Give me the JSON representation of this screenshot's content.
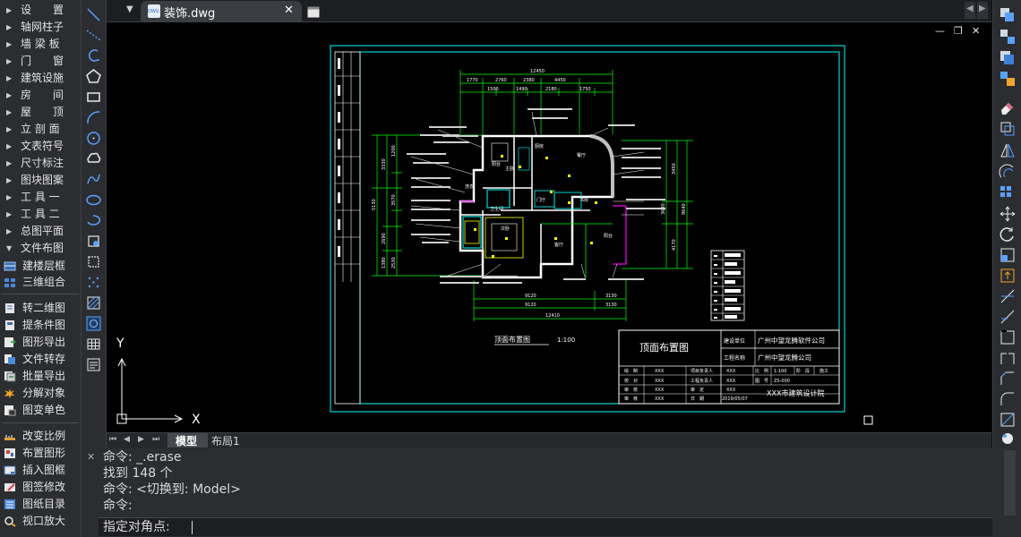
{
  "left_menu": {
    "items": [
      {
        "label": "设　　置",
        "type": "arrow"
      },
      {
        "label": "轴网柱子",
        "type": "arrow"
      },
      {
        "label": "墙 梁 板",
        "type": "arrow"
      },
      {
        "label": "门　　窗",
        "type": "arrow"
      },
      {
        "label": "建筑设施",
        "type": "arrow"
      },
      {
        "label": "房　　间",
        "type": "arrow"
      },
      {
        "label": "屋　　顶",
        "type": "arrow"
      },
      {
        "label": "立 剖 面",
        "type": "arrow"
      },
      {
        "label": "文表符号",
        "type": "arrow"
      },
      {
        "label": "尺寸标注",
        "type": "arrow"
      },
      {
        "label": "图块图案",
        "type": "arrow"
      },
      {
        "label": "工 具 一",
        "type": "arrow"
      },
      {
        "label": "工 具 二",
        "type": "arrow"
      },
      {
        "label": "总图平面",
        "type": "arrow"
      },
      {
        "label": "文件布图",
        "type": "open"
      }
    ],
    "file_tools": [
      {
        "label": "建楼层框",
        "icon": "floor-frame-icon"
      },
      {
        "label": "三维组合",
        "icon": "3d-combine-icon"
      },
      {
        "label": "转二维图",
        "icon": "to-2d-icon"
      },
      {
        "label": "提条件图",
        "icon": "condition-drawing-icon"
      },
      {
        "label": "图形导出",
        "icon": "export-drawing-icon"
      },
      {
        "label": "文件转存",
        "icon": "file-convert-icon"
      },
      {
        "label": "批量导出",
        "icon": "batch-export-icon"
      },
      {
        "label": "分解对象",
        "icon": "explode-icon"
      },
      {
        "label": "图变单色",
        "icon": "monochrome-icon"
      },
      {
        "label": "改变比例",
        "icon": "scale-icon"
      },
      {
        "label": "布置图形",
        "icon": "place-drawing-icon"
      },
      {
        "label": "插入图框",
        "icon": "insert-frame-icon"
      },
      {
        "label": "图签修改",
        "icon": "title-block-icon"
      },
      {
        "label": "图纸目录",
        "icon": "drawing-list-icon"
      },
      {
        "label": "视口放大",
        "icon": "viewport-zoom-icon"
      }
    ]
  },
  "tab": {
    "title": "装饰.dwg",
    "close": "✕",
    "badge": "DWG"
  },
  "window_controls": {
    "minimize": "—",
    "restore": "❐",
    "close": "✕"
  },
  "layout_tabs": {
    "model": "模型",
    "layout1": "布局1"
  },
  "ucs": {
    "x": "X",
    "y": "Y"
  },
  "command": {
    "lines": [
      "命令: _.erase",
      "找到 148 个",
      "命令: <切换到: Model>",
      "命令:"
    ],
    "prompt": "指定对角点: "
  },
  "drawing": {
    "plan_title": "顶面布置图",
    "plan_scale": "1:100",
    "title_block": {
      "drawing_name": "顶面布置图",
      "unit_label": "建设单位",
      "unit_value": "广州中望龙腾软件公司",
      "project_label": "工程名称",
      "project_value": "广州中望龙腾公司",
      "institute": "XXX市建筑设计院",
      "rows": [
        {
          "k": "绘　制",
          "v": "XXX",
          "k2": "项目负责人",
          "v2": "XXX"
        },
        {
          "k": "校　对",
          "v": "XXX",
          "k2": "工程负责人",
          "v2": "XXX"
        },
        {
          "k": "审　核",
          "v": "XXX",
          "k2": "审　定",
          "v2": "XXX"
        },
        {
          "k": "审　核",
          "v": "XXX",
          "k2": "日　期",
          "v2": "2019/05/07"
        }
      ],
      "scale_label": "比　例",
      "scale_value": "1:100",
      "code_label": "图　号",
      "code_value": "ZS-000",
      "stage_label": "阶　段",
      "stage_value": "施工图",
      "phase": "施工"
    },
    "dims_top": [
      "12450",
      "1770",
      "2760",
      "2380",
      "4450",
      "1500",
      "1490",
      "2180",
      "1750"
    ],
    "dims_bottom": [
      "9120",
      "3130",
      "9120",
      "3130",
      "12410"
    ],
    "dims_left": [
      "3330",
      "5130",
      "2690",
      "2530",
      "3570",
      "1200",
      "1380"
    ],
    "dims_right": [
      "3450",
      "9640",
      "4170",
      "3630"
    ],
    "rooms": [
      "阳台",
      "主卧",
      "厨房",
      "餐厅",
      "客厅",
      "卫生间",
      "书房",
      "次卧",
      "阳台",
      "洗衣",
      "门厅"
    ]
  },
  "colors": {
    "frame": "#00ffff",
    "wall": "#ffffff",
    "dim": "#00ff00",
    "text": "#ffffff",
    "magenta": "#ff00ff",
    "yellow": "#ffff00"
  }
}
